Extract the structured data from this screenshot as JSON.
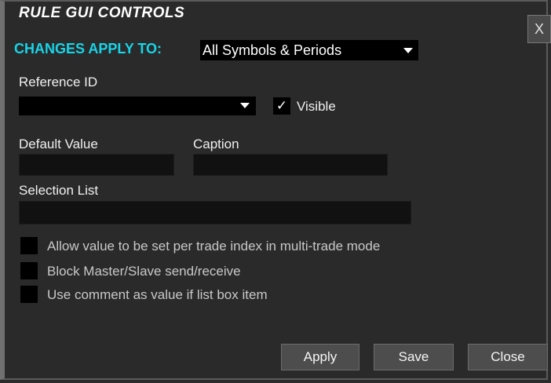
{
  "dialog": {
    "title": "RULE GUI CONTROLS",
    "close_glyph": "X"
  },
  "apply_to": {
    "label": "CHANGES APPLY TO:",
    "selected": "All Symbols & Periods"
  },
  "reference_id": {
    "label": "Reference ID",
    "value": ""
  },
  "visible": {
    "label": "Visible",
    "checked": true,
    "glyph": "✓"
  },
  "default_value": {
    "label": "Default Value",
    "value": ""
  },
  "caption": {
    "label": "Caption",
    "value": ""
  },
  "selection_list": {
    "label": "Selection List",
    "value": ""
  },
  "options": [
    {
      "label": "Allow value to be set per trade index in multi-trade mode",
      "checked": false
    },
    {
      "label": "Block Master/Slave send/receive",
      "checked": false
    },
    {
      "label": "Use comment as value if list box item",
      "checked": false
    }
  ],
  "buttons": {
    "apply": "Apply",
    "save": "Save",
    "close": "Close"
  },
  "colors": {
    "accent": "#18d4e8",
    "background": "#2a2a2a",
    "button": "#4d4d4d"
  },
  "icons": [
    "close-icon",
    "chevron-down-icon",
    "checkmark-icon"
  ]
}
